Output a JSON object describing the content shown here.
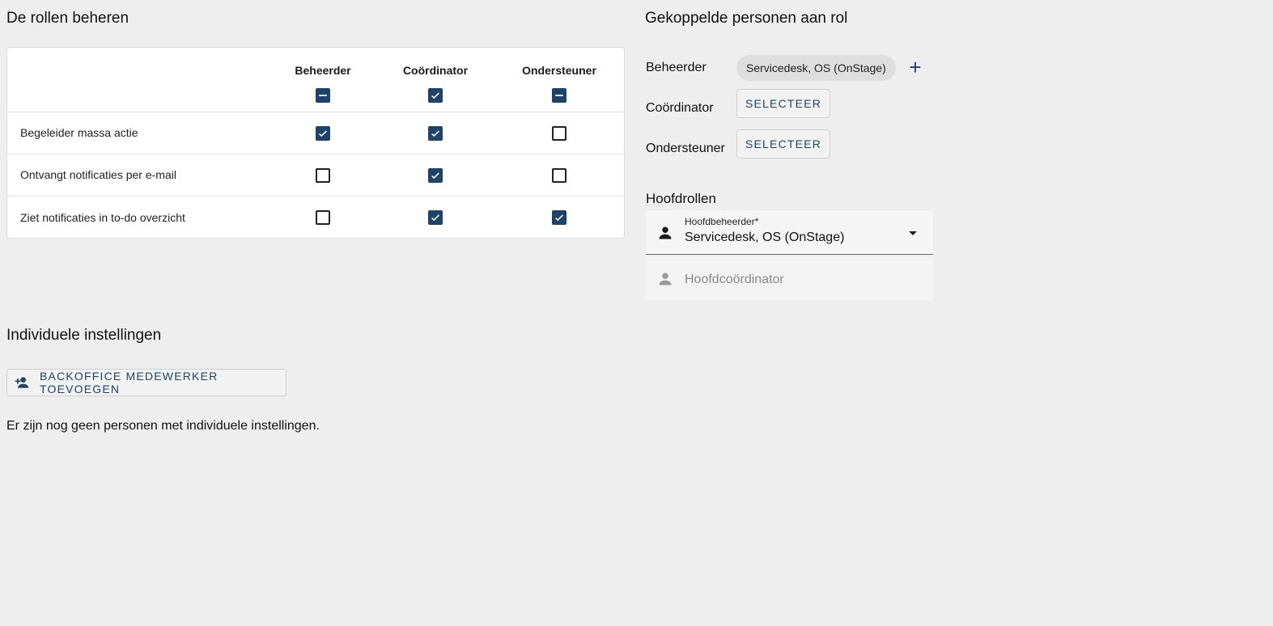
{
  "roles_section": {
    "title": "De rollen beheren",
    "columns": [
      "Beheerder",
      "Coördinator",
      "Ondersteuner"
    ],
    "header_states": [
      "indeterminate",
      "checked",
      "indeterminate"
    ],
    "rows": [
      {
        "label": "Begeleider massa actie",
        "states": [
          "checked",
          "checked",
          "unchecked"
        ]
      },
      {
        "label": "Ontvangt notificaties per e-mail",
        "states": [
          "unchecked",
          "checked",
          "unchecked"
        ]
      },
      {
        "label": "Ziet notificaties in to-do overzicht",
        "states": [
          "unchecked",
          "checked",
          "checked"
        ]
      }
    ]
  },
  "linked_section": {
    "title": "Gekoppelde personen aan rol",
    "beheerder_label": "Beheerder",
    "beheerder_chip": "Servicedesk, OS (OnStage)",
    "coordinator_label": "Coördinator",
    "ondersteuner_label": "Ondersteuner",
    "select_label": "SELECTEER",
    "plus_symbol": "+"
  },
  "main_roles": {
    "title": "Hoofdrollen",
    "hoofdbeheerder_label": "Hoofdbeheerder*",
    "hoofdbeheerder_value": "Servicedesk, OS (OnStage)",
    "hoofdcoordinator_placeholder": "Hoofdcoördinator"
  },
  "individual": {
    "title": "Individuele instellingen",
    "add_button": "BACKOFFICE MEDEWERKER TOEVOEGEN",
    "empty_text": "Er zijn nog geen personen met individuele instellingen."
  },
  "colors": {
    "accent": "#1f4366",
    "background": "#eeeeee"
  }
}
